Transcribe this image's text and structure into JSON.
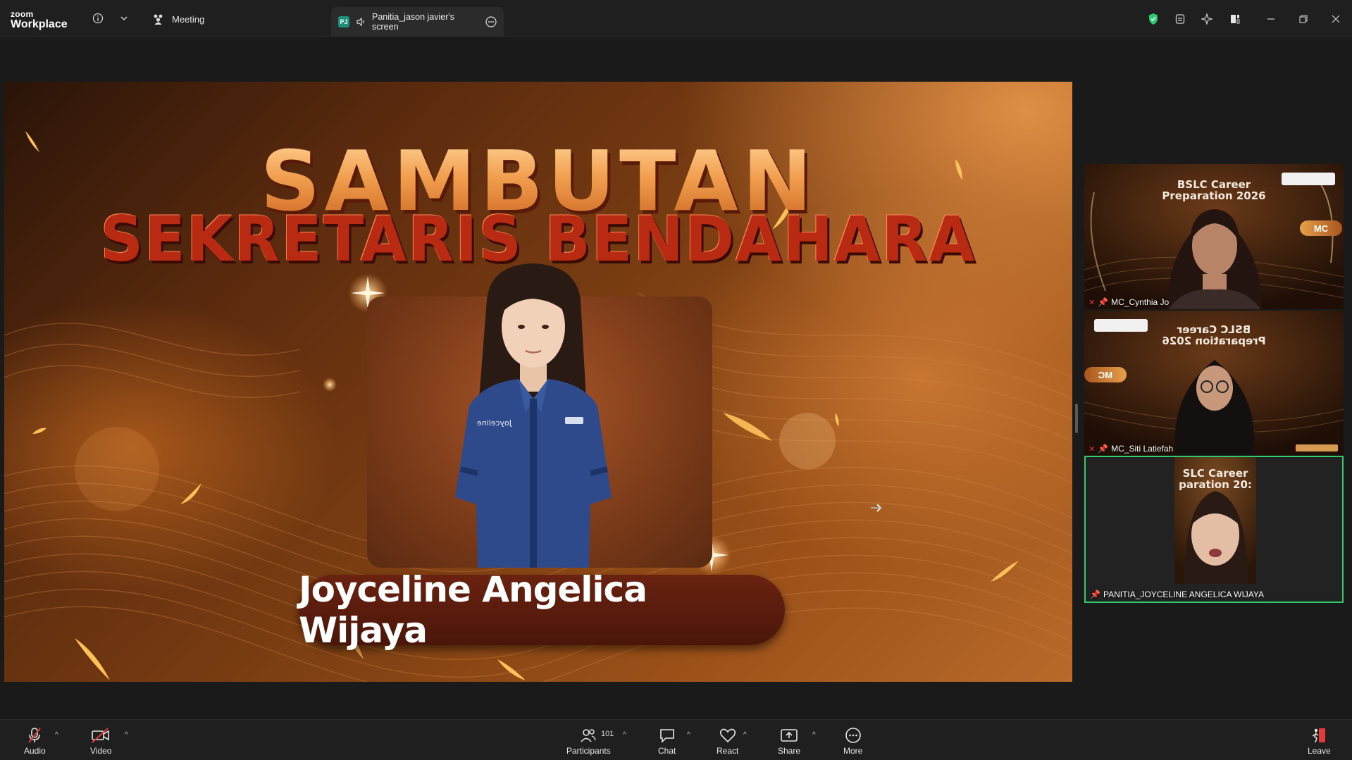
{
  "titlebar": {
    "brand_top": "zoom",
    "brand_bottom": "Workplace",
    "meeting_tab_label": "Meeting",
    "share_tab_badge": "PJ",
    "share_tab_label": "Panitia_jason javier's screen"
  },
  "slide": {
    "title_line1": "SAMBUTAN",
    "title_line2": "SEKRETARIS BENDAHARA",
    "speaker_name": "Joyceline Angelica Wijaya",
    "shirt_text": "Joyceline"
  },
  "gallery": [
    {
      "name": "MC_Cynthia Jo",
      "caption_line1": "BSLC Career",
      "caption_line2": "Preparation 2026",
      "badge": "MC",
      "muted": true
    },
    {
      "name": "MC_Siti Latiefah",
      "caption_line1": "BSLC Career",
      "caption_line2": "Preparation 2026",
      "badge": "MC",
      "muted": true
    },
    {
      "name": "PANITIA_JOYCELINE ANGELICA WIJAYA",
      "caption_line1": "SLC Career",
      "caption_line2": "paration 20:",
      "active": true,
      "muted": false
    }
  ],
  "toolbar": {
    "audio": "Audio",
    "video": "Video",
    "participants": "Participants",
    "participants_count": "101",
    "chat": "Chat",
    "react": "React",
    "share": "Share",
    "more": "More",
    "leave": "Leave"
  },
  "colors": {
    "active_speaker_border": "#2ecc71",
    "leave_red": "#e23b3b",
    "shield_green": "#2ecc71"
  }
}
